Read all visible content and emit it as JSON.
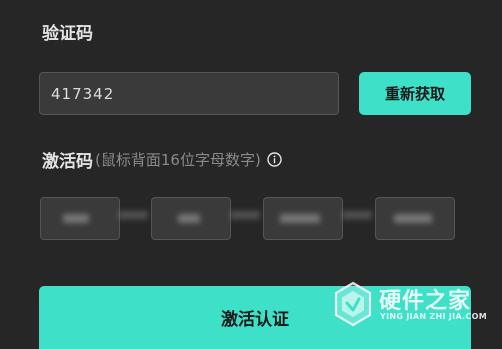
{
  "verification": {
    "label": "验证码",
    "code_value": "417342",
    "resend_label": "重新获取"
  },
  "activation": {
    "label": "激活码",
    "hint": "(鼠标背面16位字母数字)",
    "info_icon": "info-circle-icon",
    "segments": [
      "",
      "",
      "",
      ""
    ],
    "submit_label": "激活认证"
  },
  "watermark": {
    "title": "硬件之家",
    "subtitle": "YING JIAN ZHI JIA.COM",
    "logo_icon": "hexagon-logo-icon"
  },
  "colors": {
    "background": "#262626",
    "accent": "#3ee0c8",
    "input_bg": "#3a3a3a",
    "input_border": "#555555",
    "text_primary": "#e3e3e3",
    "text_hint": "#8a8a8a"
  }
}
